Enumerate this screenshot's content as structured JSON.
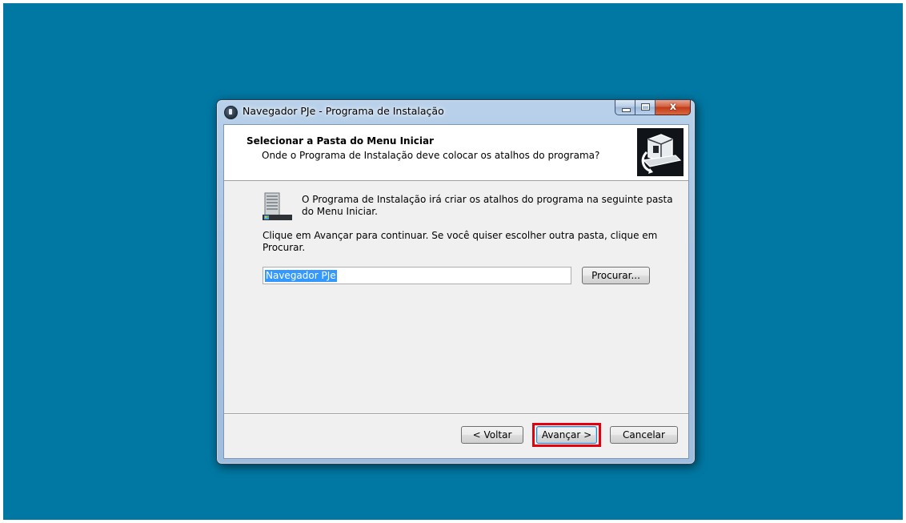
{
  "window": {
    "title": "Navegador PJe - Programa de Instalação",
    "buttons": {
      "minimize": "–",
      "maximize": "□",
      "close": "x"
    }
  },
  "header": {
    "title": "Selecionar a Pasta do Menu Iniciar",
    "subtitle": "Onde o Programa de Instalação deve colocar os atalhos do programa?"
  },
  "body": {
    "info_line1": "O Programa de Instalação irá criar os atalhos do programa na seguinte pasta",
    "info_line2": "do Menu Iniciar.",
    "instruction_line1": "Clique em Avançar para continuar. Se você quiser escolher outra pasta, clique em",
    "instruction_line2": "Procurar.",
    "folder_value": "Navegador PJe",
    "browse_label": "Procurar..."
  },
  "footer": {
    "back_label": "< Voltar",
    "next_label": "Avançar >",
    "cancel_label": "Cancelar"
  },
  "colors": {
    "desktop": "#0178a3",
    "highlight": "#e3000f",
    "selection": "#3399ff"
  },
  "icons": {
    "app": "pje-app-icon",
    "wizard": "computer-setup-icon",
    "folder": "start-menu-folder-icon"
  }
}
